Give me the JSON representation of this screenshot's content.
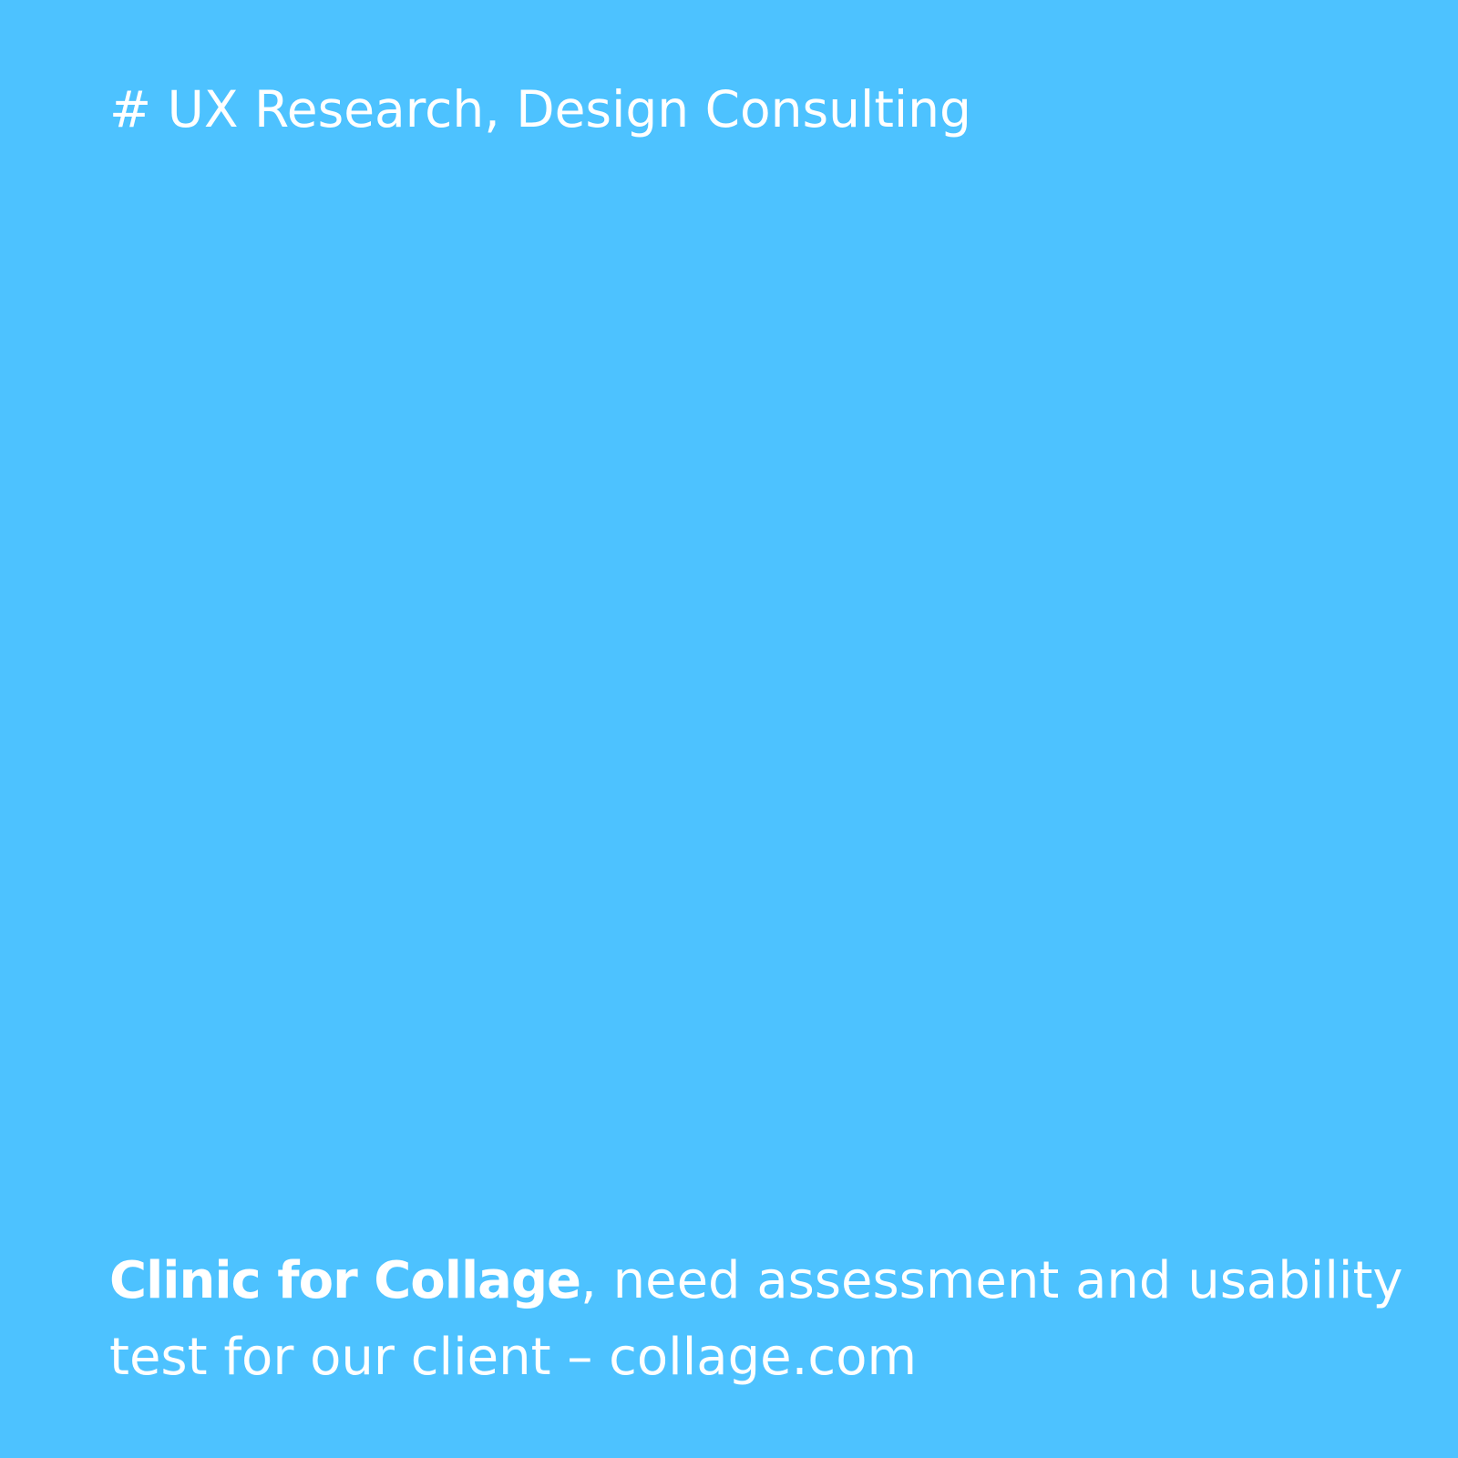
{
  "card": {
    "background_color": "#4dc2ff",
    "text_color": "#ffffff",
    "tag_line": "# UX Research, Design Consulting",
    "description": {
      "project_name": "Clinic for Collage",
      "line1_rest": ", need assessment and usability",
      "line2": "test for our client – collage.com"
    }
  }
}
